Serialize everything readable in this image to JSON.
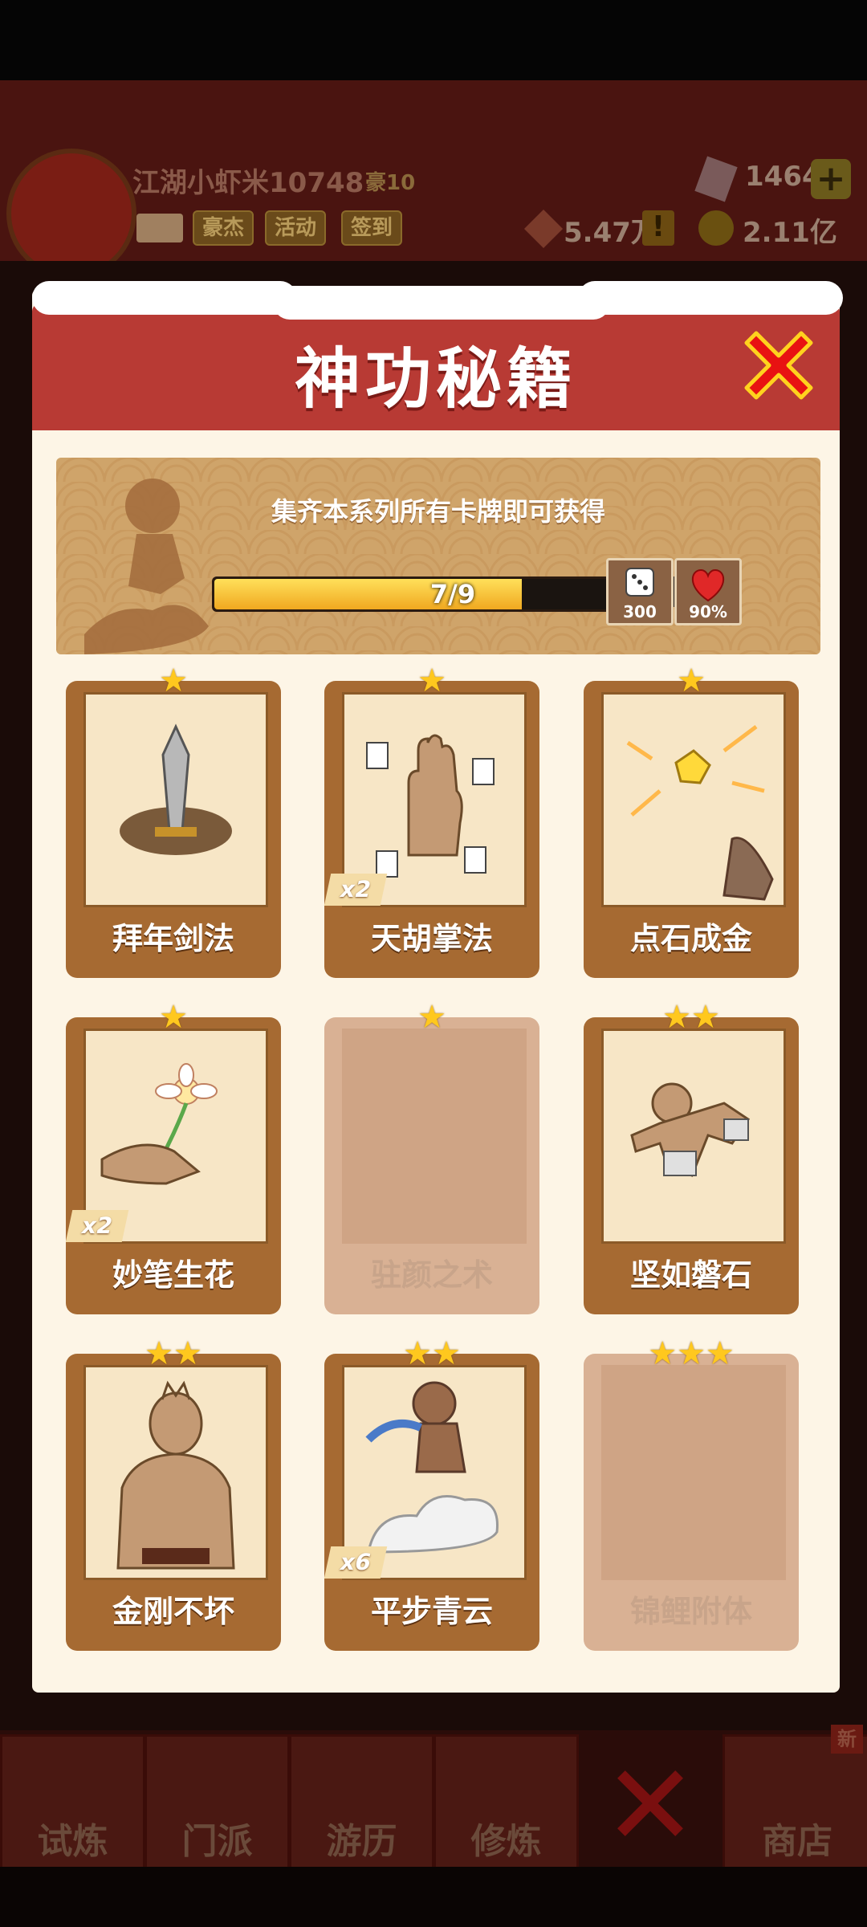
{
  "header": {
    "username": "江湖小虾米10748",
    "vip": "豪10",
    "buttons": [
      "豪杰",
      "活动",
      "签到"
    ],
    "gems": "1464",
    "coins_a": "5.47万",
    "coins_b": "2.11亿",
    "alert": "!",
    "plus": "+"
  },
  "nav": {
    "tabs": [
      "试炼",
      "门派",
      "游历",
      "修炼",
      "商店"
    ],
    "new_badge": "新"
  },
  "modal": {
    "title": "神功秘籍",
    "banner_text": "集齐本系列所有卡牌即可获得",
    "progress": {
      "current": 7,
      "total": 9,
      "label": "7/9"
    },
    "rewards": [
      {
        "icon": "dice-icon",
        "label": "300"
      },
      {
        "icon": "heart-icon",
        "label": "90%"
      }
    ],
    "cards": [
      {
        "name": "拜年剑法",
        "stars": 1,
        "count": "",
        "locked": false,
        "art": "sword-art"
      },
      {
        "name": "天胡掌法",
        "stars": 1,
        "count": "x2",
        "locked": false,
        "art": "palm-art"
      },
      {
        "name": "点石成金",
        "stars": 1,
        "count": "",
        "locked": false,
        "art": "gold-art"
      },
      {
        "name": "妙笔生花",
        "stars": 1,
        "count": "x2",
        "locked": false,
        "art": "flower-art"
      },
      {
        "name": "驻颜之术",
        "stars": 1,
        "count": "",
        "locked": true,
        "art": ""
      },
      {
        "name": "坚如磐石",
        "stars": 2,
        "count": "",
        "locked": false,
        "art": "rock-art"
      },
      {
        "name": "金刚不坏",
        "stars": 2,
        "count": "",
        "locked": false,
        "art": "muscle-art"
      },
      {
        "name": "平步青云",
        "stars": 2,
        "count": "x6",
        "locked": false,
        "art": "cloud-art"
      },
      {
        "name": "锦鲤附体",
        "stars": 3,
        "count": "",
        "locked": true,
        "art": ""
      }
    ]
  },
  "colors": {
    "modal_header": "#b83a34",
    "card_frame": "#a66a32",
    "star": "#ffc81e",
    "progress": "#f0a820"
  }
}
